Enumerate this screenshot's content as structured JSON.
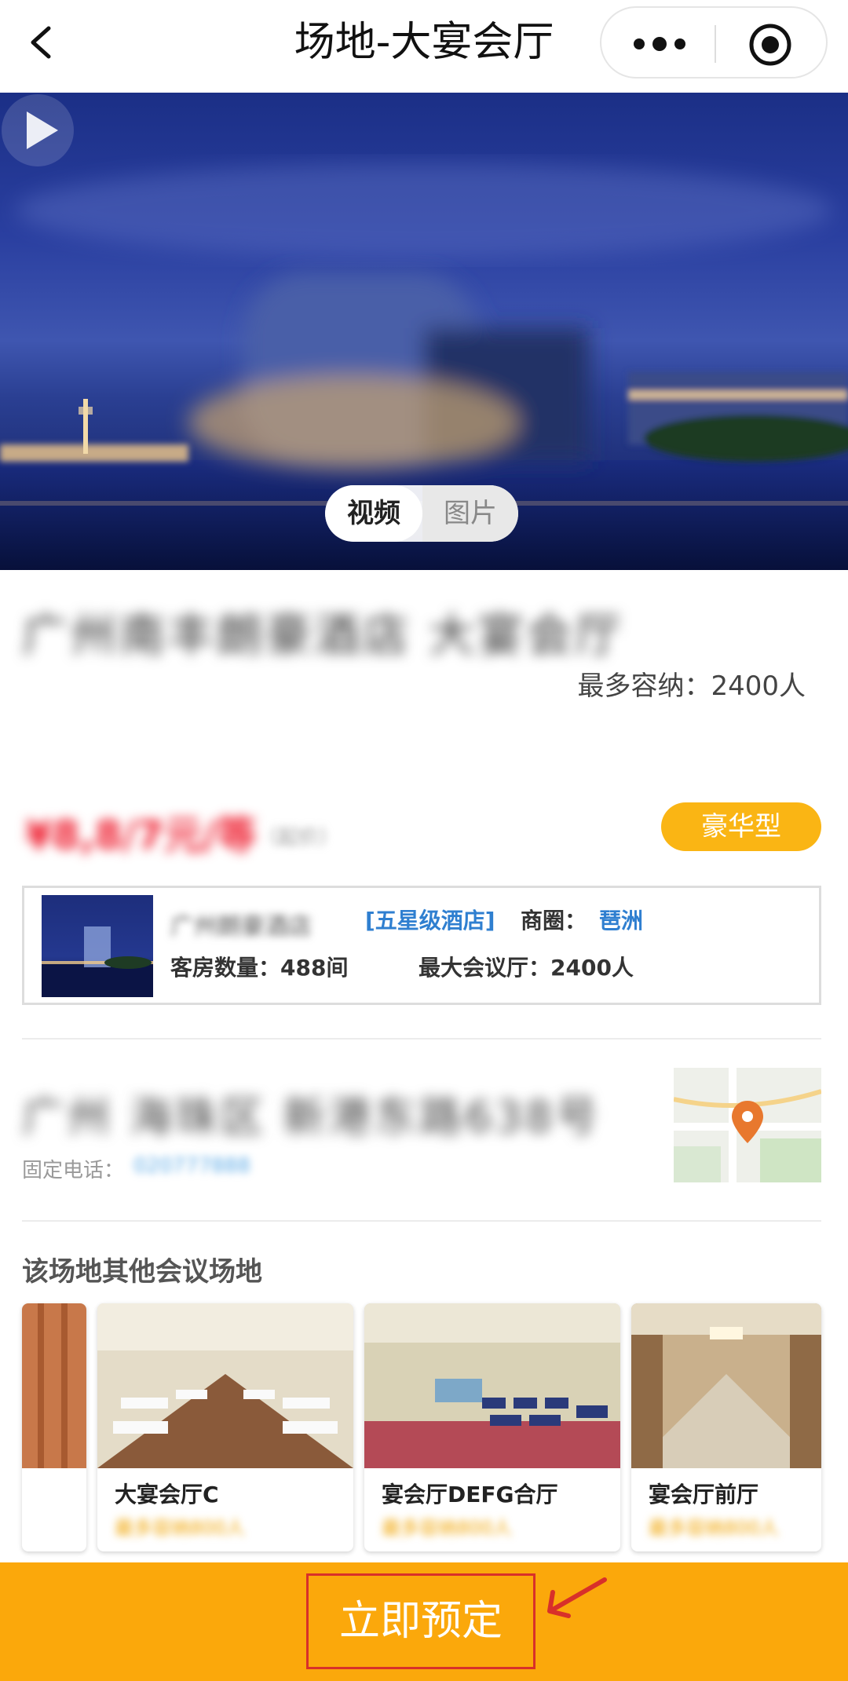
{
  "header": {
    "title": "场地-大宴会厅",
    "back_icon": "chevron-left-icon",
    "more_icon": "more-dots-icon",
    "target_icon": "target-icon"
  },
  "hero": {
    "toggle_video": "视频",
    "toggle_photo": "图片",
    "play_icon": "play-icon"
  },
  "venue": {
    "title": "广州南丰朗豪酒店 大宴会厅",
    "capacity": "最多容纳：2400人",
    "price": "¥8,8/7元/等",
    "price_note": "（起价）",
    "tier": "豪华型"
  },
  "hotel": {
    "name": "广州朗豪酒店",
    "star": "[五星级酒店]",
    "biz_label": "商圈：",
    "biz_value": "琶洲",
    "rooms": "客房数量：488间",
    "max_hall": "最大会议厅：2400人"
  },
  "address": {
    "text": "广州 海珠区 新港东路638号",
    "phone_label": "固定电话：",
    "phone_value": "020777888"
  },
  "other": {
    "section_title": "该场地其他会议场地",
    "venues": [
      {
        "name": "大宴会厅C",
        "sub": "最多容纳800人"
      },
      {
        "name": "宴会厅DEFG合厅",
        "sub": "最多容纳800人"
      },
      {
        "name": "宴会厅前厅",
        "sub": "最多容纳800人"
      }
    ]
  },
  "bottom": {
    "book_label": "立即预定"
  },
  "colors": {
    "accent": "#fba80b",
    "badge": "#fab514",
    "link": "#2f7fd0",
    "highlight_border": "#d8302a"
  }
}
